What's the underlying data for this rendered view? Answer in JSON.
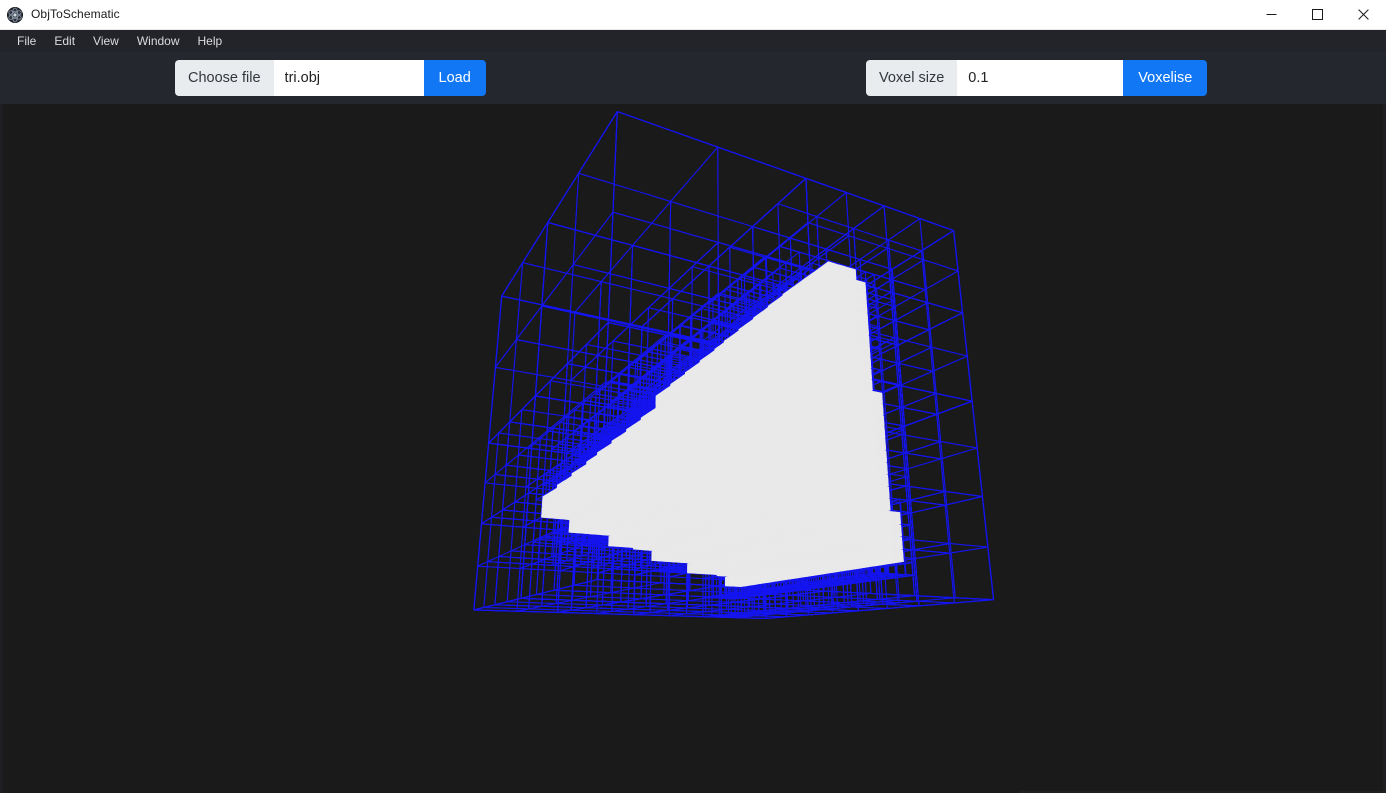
{
  "window": {
    "title": "ObjToSchematic",
    "app_icon": "app-logo-icon",
    "controls": {
      "minimize": "minimize-icon",
      "maximize": "maximize-icon",
      "close": "close-icon"
    }
  },
  "menubar": {
    "items": [
      {
        "label": "File"
      },
      {
        "label": "Edit"
      },
      {
        "label": "View"
      },
      {
        "label": "Window"
      },
      {
        "label": "Help"
      }
    ]
  },
  "toolbar": {
    "file_group": {
      "choose_label": "Choose file",
      "file_value": "tri.obj",
      "file_placeholder": "",
      "load_label": "Load"
    },
    "voxel_group": {
      "voxel_size_label": "Voxel size",
      "voxel_size_value": "0.1",
      "voxel_size_placeholder": "",
      "voxelise_label": "Voxelise"
    }
  },
  "viewport": {
    "name": "3d-voxel-preview",
    "background_color": "#1a1a1a",
    "wireframe_color": "#1515f0",
    "voxel_fill_color": "#e8e8e8",
    "model": "tri.obj",
    "render_mode": "octree-wireframe-with-voxels"
  },
  "colors": {
    "accent_blue": "#1177f5",
    "titlebar_bg": "#ffffff",
    "menubar_bg": "#222429",
    "toolbar_bg": "#24272e",
    "viewport_bg": "#1a1a1a",
    "wire_blue": "#1515f0",
    "voxel_white": "#e8e8e8"
  }
}
